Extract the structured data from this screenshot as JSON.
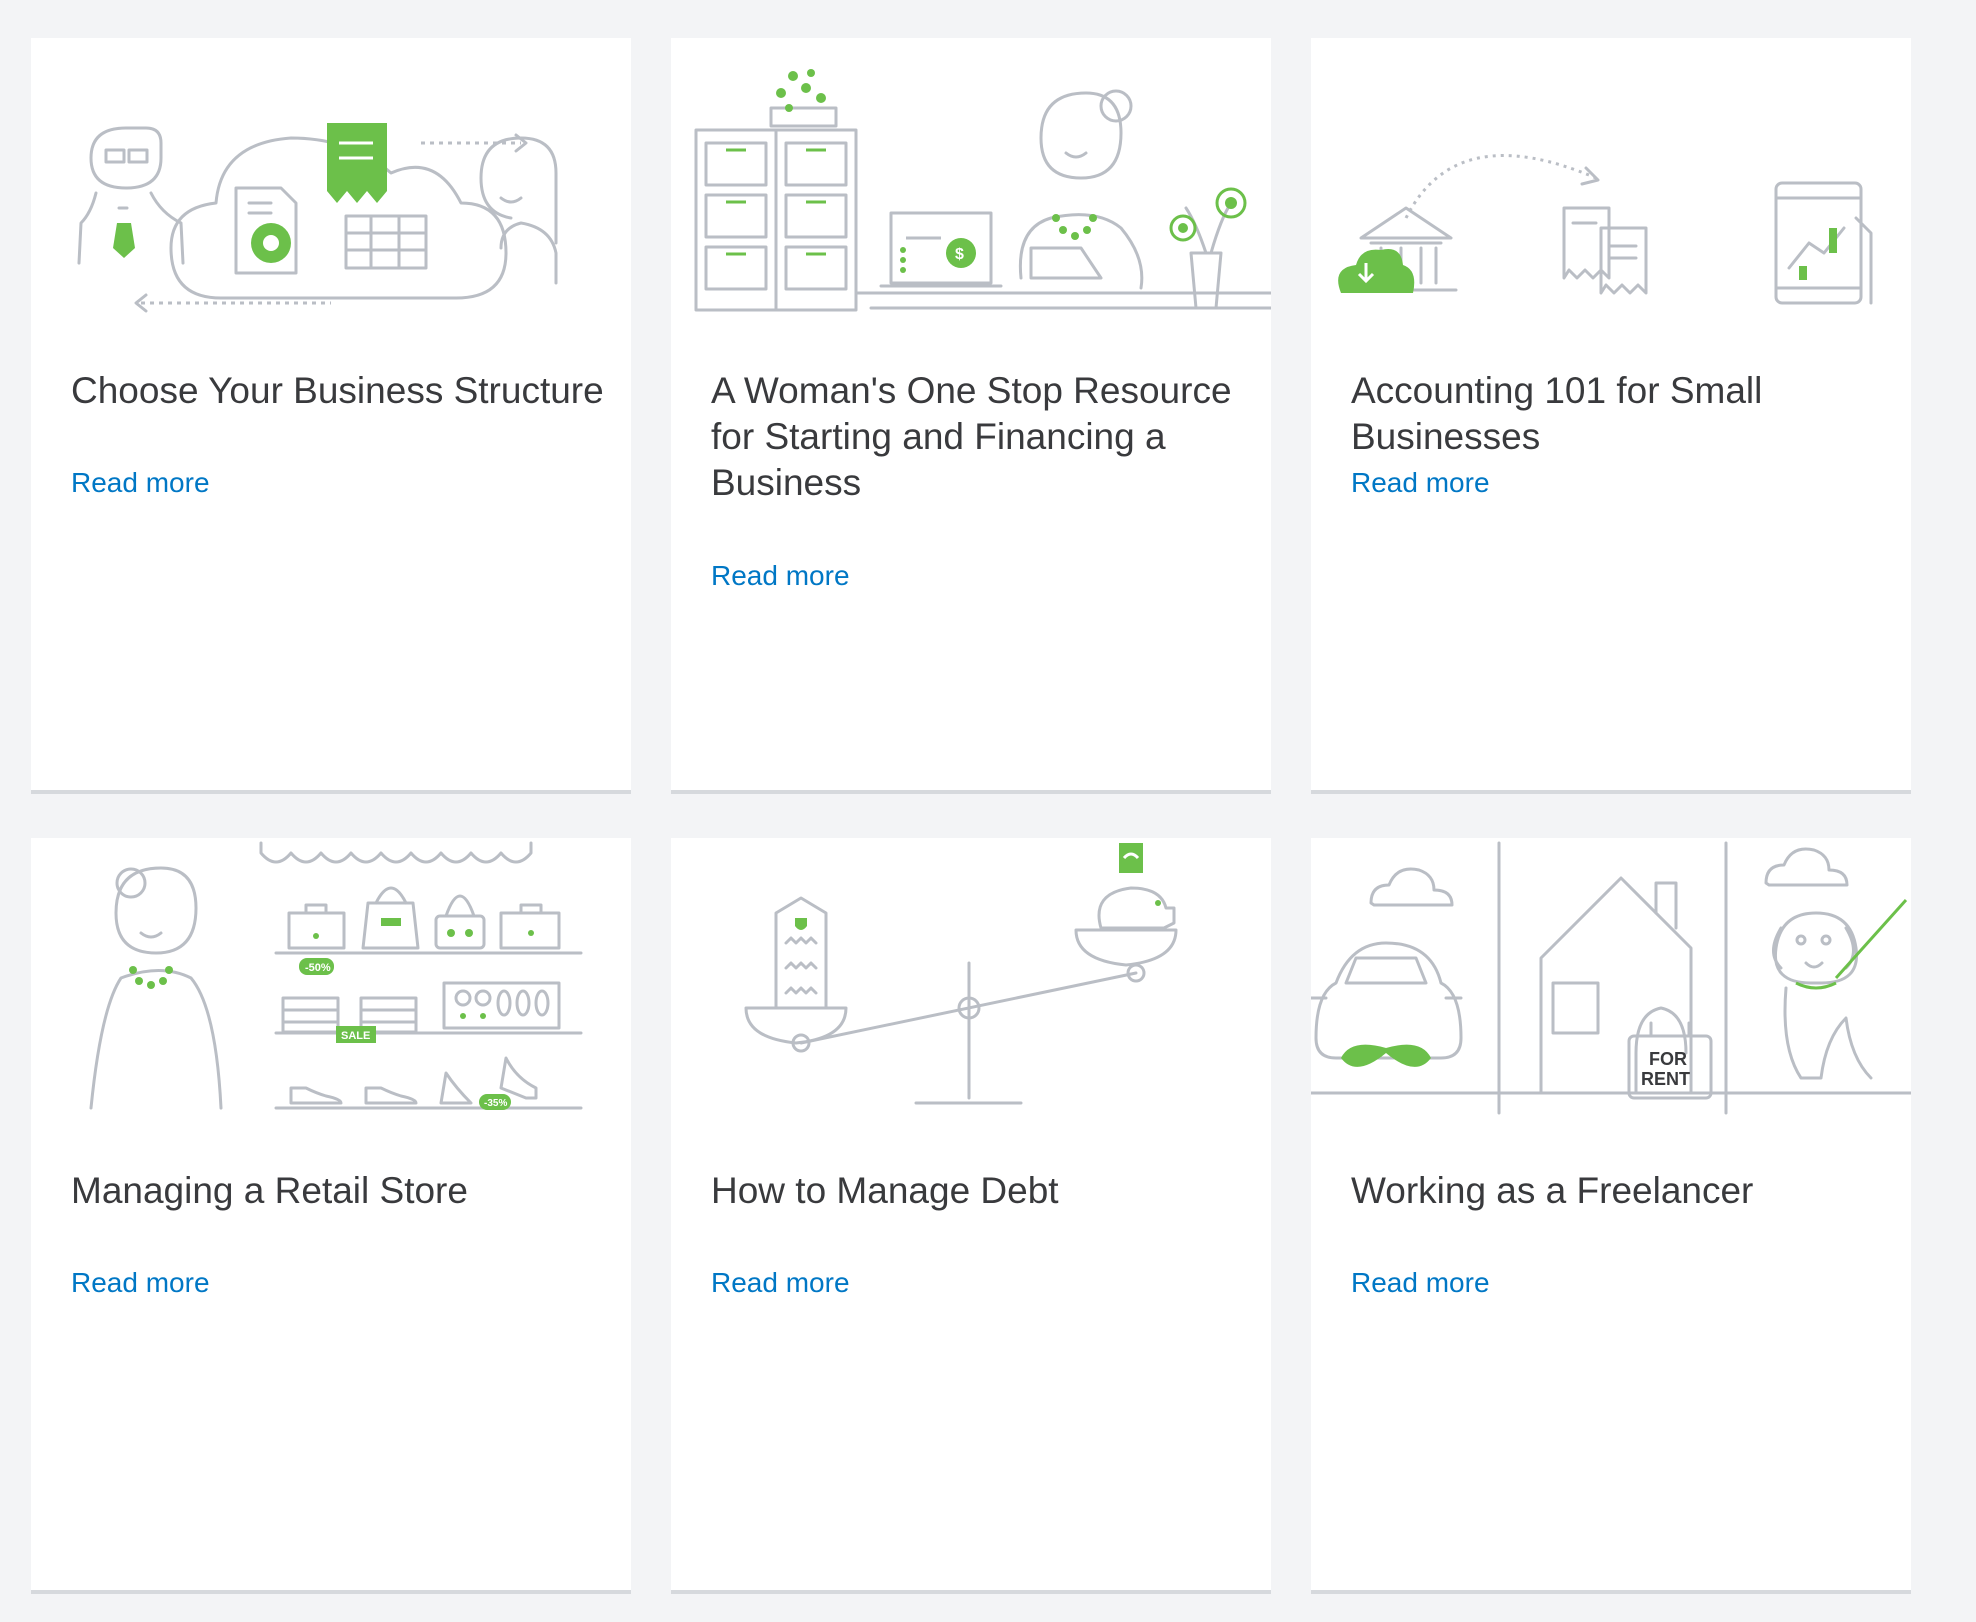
{
  "colors": {
    "accent": "#6cc04a",
    "link": "#0077c5",
    "text": "#393a3d",
    "background": "#f3f4f6"
  },
  "cards": [
    {
      "title": "Choose Your Business Structure",
      "link": "Read more",
      "illustration": "people-cloud-documents-icon"
    },
    {
      "title": "A Woman's One Stop Resource for Starting and Financing a Business",
      "link": "Read more",
      "illustration": "woman-office-desk-icon"
    },
    {
      "title": "Accounting 101 for Small Businesses",
      "link": "Read more",
      "illustration": "bank-receipts-tablet-icon"
    },
    {
      "title": "Managing a Retail Store",
      "link": "Read more",
      "illustration": "woman-retail-shelves-icon",
      "illustration_labels": {
        "discount_1": "-50%",
        "sale": "SALE",
        "discount_2": "-35%"
      }
    },
    {
      "title": "How to Manage Debt",
      "link": "Read more",
      "illustration": "seesaw-building-piggybank-icon"
    },
    {
      "title": "Working as a Freelancer",
      "link": "Read more",
      "illustration": "car-house-dog-icon",
      "illustration_labels": {
        "sign_line1": "FOR",
        "sign_line2": "RENT"
      }
    }
  ]
}
